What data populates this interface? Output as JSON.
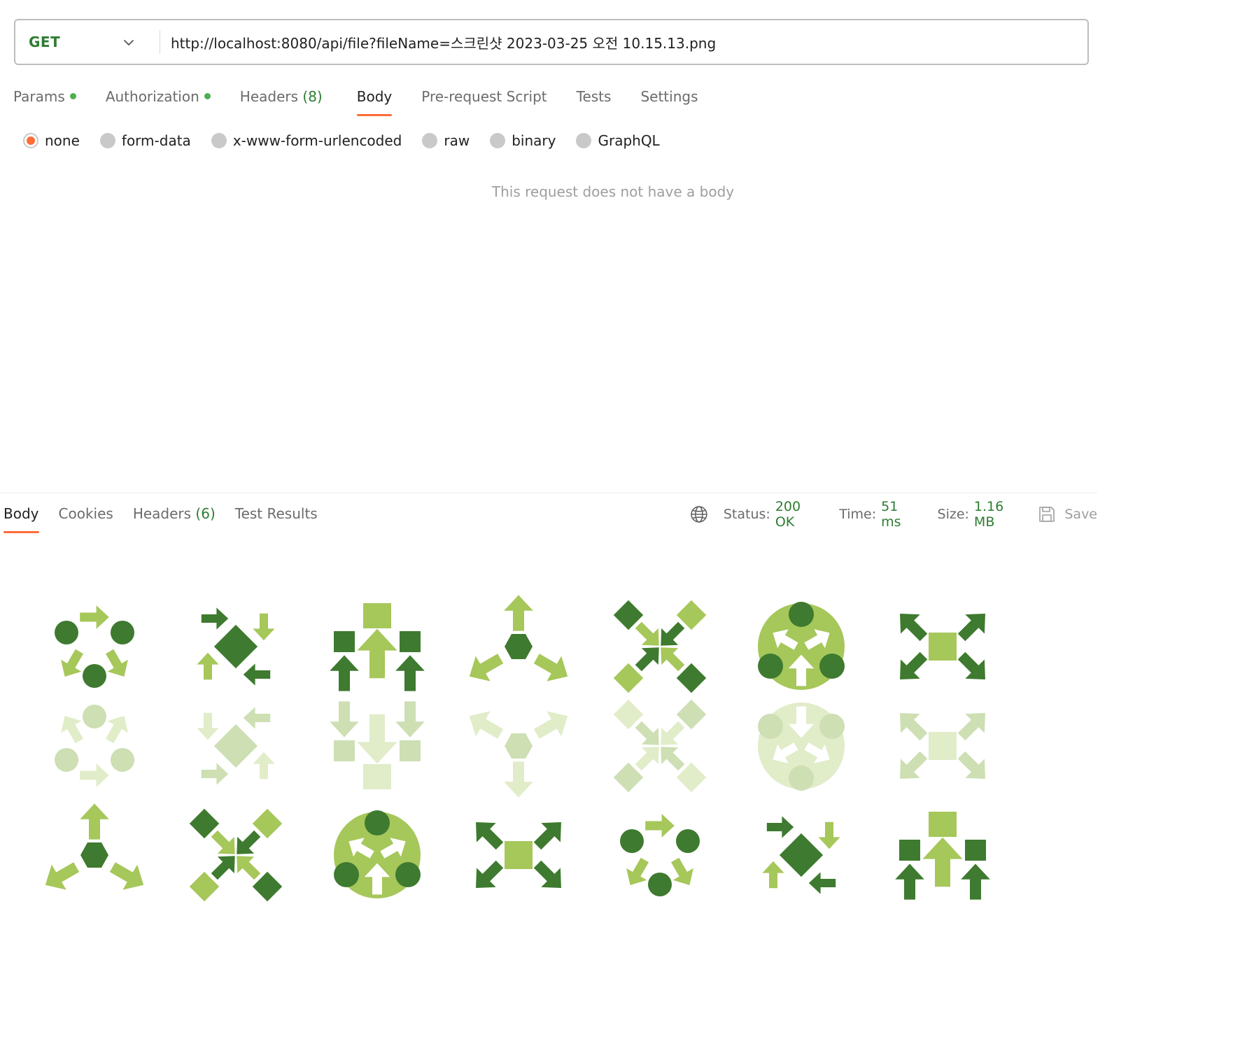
{
  "request": {
    "method": "GET",
    "url": "http://localhost:8080/api/file?fileName=스크린샷 2023-03-25 오전 10.15.13.png"
  },
  "request_tabs": [
    {
      "label": "Params",
      "dot": true
    },
    {
      "label": "Authorization",
      "dot": true
    },
    {
      "label": "Headers",
      "count": "(8)"
    },
    {
      "label": "Body",
      "active": true
    },
    {
      "label": "Pre-request Script"
    },
    {
      "label": "Tests"
    },
    {
      "label": "Settings"
    }
  ],
  "body_types": [
    {
      "label": "none",
      "selected": true
    },
    {
      "label": "form-data"
    },
    {
      "label": "x-www-form-urlencoded"
    },
    {
      "label": "raw"
    },
    {
      "label": "binary"
    },
    {
      "label": "GraphQL"
    }
  ],
  "empty_body_message": "This request does not have a body",
  "response": {
    "tabs": [
      {
        "label": "Body",
        "active": true
      },
      {
        "label": "Cookies"
      },
      {
        "label": "Headers",
        "count": "(6)"
      },
      {
        "label": "Test Results"
      }
    ],
    "status_label": "Status:",
    "status_value": "200 OK",
    "time_label": "Time:",
    "time_value": "51 ms",
    "size_label": "Size:",
    "size_value": "1.16 MB",
    "save_label": "Save"
  },
  "colors": {
    "accent": "#ff6c37",
    "success": "#2e7d32",
    "icon_dark": "#3e7a2f",
    "icon_light": "#a6c75a",
    "icon_faded_dark": "#cddfb3",
    "icon_faded_light": "#e1ecc9"
  }
}
